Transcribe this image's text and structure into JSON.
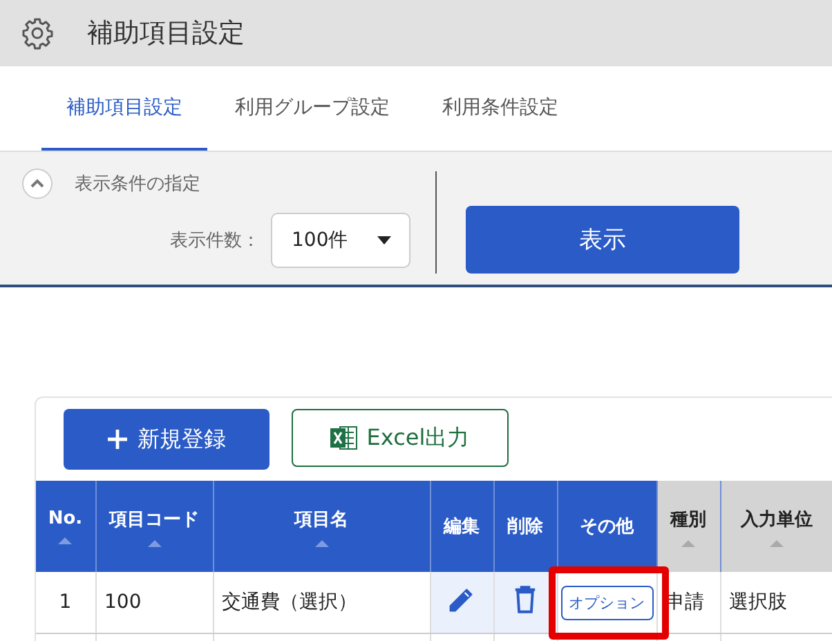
{
  "header": {
    "title": "補助項目設定"
  },
  "tabs": [
    {
      "label": "補助項目設定",
      "selected": true
    },
    {
      "label": "利用グループ設定",
      "selected": false
    },
    {
      "label": "利用条件設定",
      "selected": false
    }
  ],
  "filter": {
    "title": "表示条件の指定",
    "expanded": true,
    "count_label": "表示件数：",
    "count_value": "100件",
    "show_button": "表示"
  },
  "toolbar": {
    "new_button": "新規登録",
    "excel_button": "Excel出力"
  },
  "table": {
    "columns": [
      {
        "label": "No.",
        "sortable": true,
        "color": "#2a5bc7"
      },
      {
        "label": "項目コード",
        "sortable": true,
        "color": "#2a5bc7"
      },
      {
        "label": "項目名",
        "sortable": true,
        "color": "#2a5bc7"
      },
      {
        "label": "編集",
        "sortable": false,
        "color": "#2a5bc7"
      },
      {
        "label": "削除",
        "sortable": false,
        "color": "#2a5bc7"
      },
      {
        "label": "その他",
        "sortable": false,
        "color": "#2a5bc7"
      },
      {
        "label": "種別",
        "sortable": true,
        "color": "#d4d4d4"
      },
      {
        "label": "入力単位",
        "sortable": true,
        "color": "#d4d4d4"
      }
    ],
    "rows": [
      {
        "cells": [
          {
            "kind": "number",
            "text": "1"
          },
          {
            "kind": "text",
            "text": "100"
          },
          {
            "kind": "text",
            "text": "交通費（選択）"
          },
          {
            "kind": "edit"
          },
          {
            "kind": "delete"
          },
          {
            "kind": "option",
            "text": "オプション",
            "highlighted": true
          },
          {
            "kind": "text",
            "text": "申請"
          },
          {
            "kind": "text",
            "text": "選択肢"
          }
        ]
      }
    ]
  }
}
